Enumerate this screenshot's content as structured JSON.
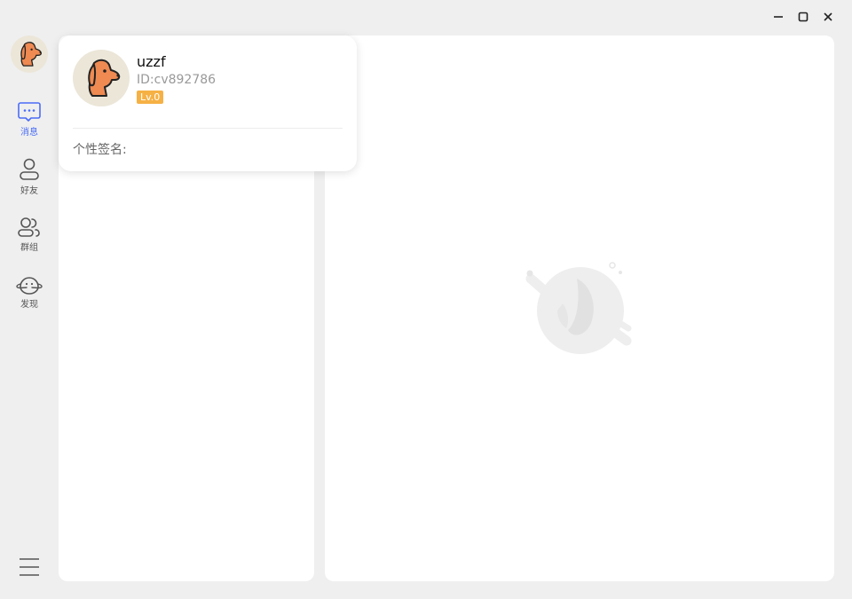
{
  "window_controls": {
    "minimize_icon": "minimize-icon",
    "maximize_icon": "maximize-icon",
    "close_icon": "close-icon"
  },
  "sidebar": {
    "avatar_icon": "dog-avatar-icon",
    "items": [
      {
        "label": "消息",
        "icon": "chat-bubble-icon",
        "active": true
      },
      {
        "label": "好友",
        "icon": "person-icon",
        "active": false
      },
      {
        "label": "群组",
        "icon": "group-icon",
        "active": false
      },
      {
        "label": "发现",
        "icon": "planet-icon",
        "active": false
      }
    ],
    "menu_icon": "hamburger-menu-icon"
  },
  "profile_popup": {
    "username": "uzzf",
    "user_id": "ID:cv892786",
    "level": "Lv.0",
    "signature_label": "个性签名:"
  },
  "colors": {
    "accent": "#4a6cf7",
    "level_badge": "#f6b145",
    "avatar_orange": "#ee8a52",
    "background": "#efefef"
  }
}
